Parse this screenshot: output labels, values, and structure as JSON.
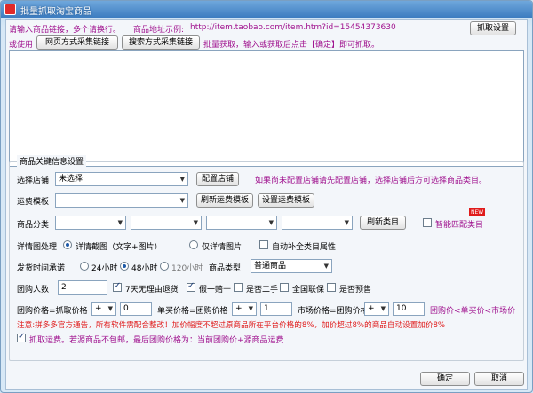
{
  "window": {
    "title": "批量抓取淘宝商品"
  },
  "top": {
    "instruction": "请输入商品链接，多个请换行。",
    "example_label": "商品地址示例:",
    "example_url": "http://item.taobao.com/item.htm?id=15454373630",
    "capture_settings": "抓取设置",
    "or_use": "或使用",
    "web_collect_link": "网页方式采集链接",
    "search_collect_link": "搜索方式采集链接",
    "batch_hint": "批量获取，输入或获取后点击【确定】即可抓取。"
  },
  "group": {
    "title": "商品关键信息设置"
  },
  "store": {
    "label": "选择店铺",
    "value": "未选择",
    "config_button": "配置店铺",
    "hint": "如果尚未配置店铺请先配置店铺，选择店铺后方可选择商品类目。"
  },
  "shipping": {
    "label": "运费模板",
    "value": "",
    "refresh_button": "刷新运费模板",
    "set_button": "设置运费模板"
  },
  "category": {
    "label": "商品分类",
    "refresh_button": "刷新类目",
    "smart_match": "智能匹配类目",
    "badge": "NEW"
  },
  "detail": {
    "label": "详情图处理",
    "opt_full": "详情截图（文字+图片）",
    "opt_images": "仅详情图片",
    "auto_complete": "自动补全类目属性"
  },
  "ship_time": {
    "label": "发货时间承诺",
    "opt_24": "24小时",
    "opt_48": "48小时",
    "opt_120": "120小时",
    "type_label": "商品类型",
    "type_value": "普通商品"
  },
  "group_buy": {
    "count_label": "团购人数",
    "count_value": "2",
    "no_reason_return": "7天无理由退货",
    "fake_compensate": "假一赔十",
    "second_hand": "是否二手",
    "national_warranty": "全国联保",
    "presale": "是否预售"
  },
  "pricing": {
    "group_price_label": "团购价格=抓取价格",
    "group_op": "+",
    "group_value": "0",
    "single_price_label": "单买价格=团购价格",
    "single_op": "+",
    "single_value": "1",
    "market_price_label": "市场价格=团购价格",
    "market_op": "+",
    "market_value": "10",
    "rule_hint": "团购价<单买价<市场价"
  },
  "notice": "注意:拼多多官方通告，所有软件需配合整改！加价幅度不超过原商品所在平台价格的8%，加价超过8%的商品自动设置加价8%",
  "freight": {
    "label": "抓取运费。若源商品不包邮，最后团购价格为：当前团购价+源商品运费"
  },
  "footer": {
    "ok": "确定",
    "cancel": "取消"
  }
}
